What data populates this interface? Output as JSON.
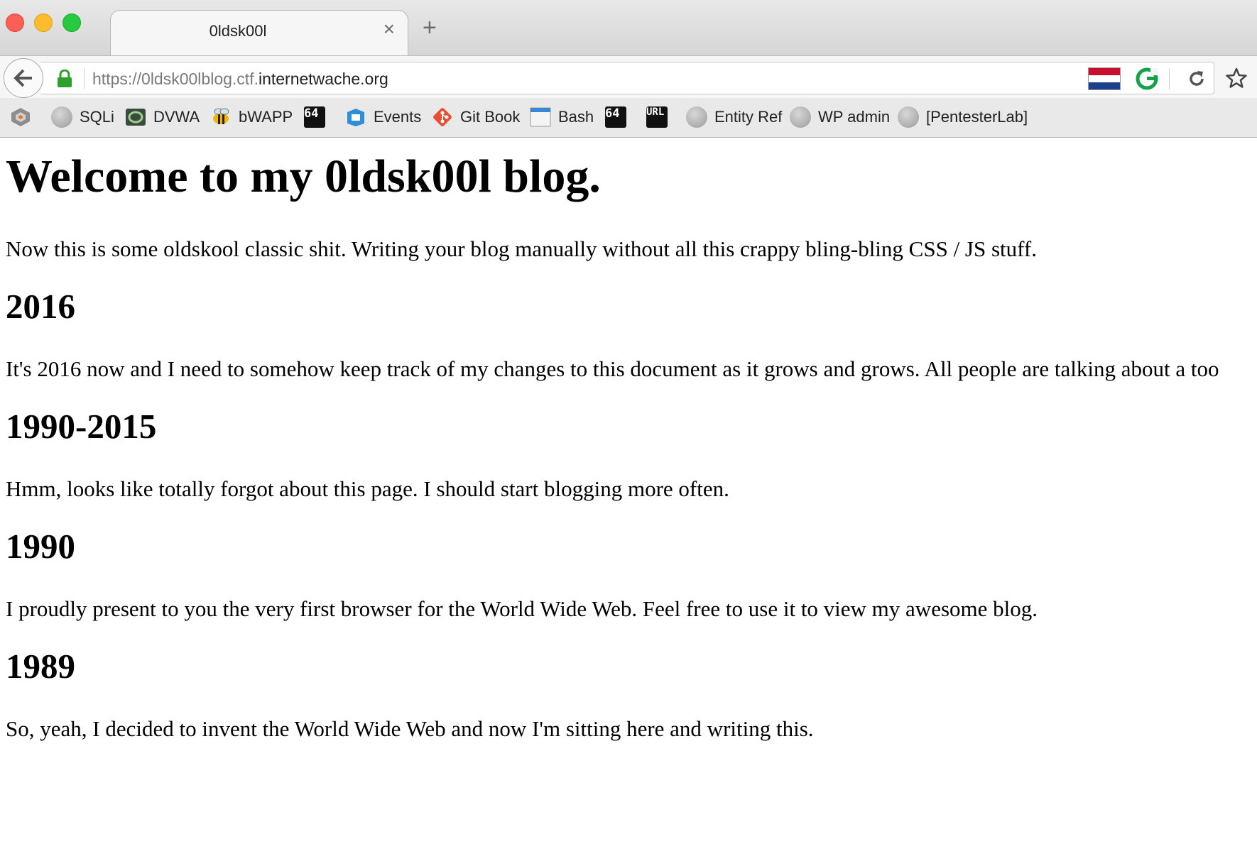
{
  "browser": {
    "tab": {
      "title": "0ldsk00l",
      "close_glyph": "×"
    },
    "new_tab_glyph": "+",
    "url": {
      "prefix": "https://0ldsk00lblog.ctf.",
      "domain": "internetwache.org"
    },
    "icons": {
      "back": "back-arrow-icon",
      "lock": "lock-icon",
      "flag": "netherlands-flag-icon",
      "extension": "grammarly-icon",
      "reload": "reload-icon",
      "bookmark_star": "star-icon"
    },
    "bookmarks": [
      {
        "label": "",
        "icon": "hackbar-icon"
      },
      {
        "label": "SQLi",
        "icon": "globe-icon"
      },
      {
        "label": "DVWA",
        "icon": "dvwa-icon"
      },
      {
        "label": "bWAPP",
        "icon": "bee-icon"
      },
      {
        "label": "",
        "icon": "base64-icon",
        "glyph": "64"
      },
      {
        "label": "Events",
        "icon": "events-icon"
      },
      {
        "label": "Git Book",
        "icon": "git-icon"
      },
      {
        "label": "Bash",
        "icon": "bash-icon"
      },
      {
        "label": "",
        "icon": "base64-icon",
        "glyph": "64"
      },
      {
        "label": "",
        "icon": "url-icon",
        "glyph": "URL"
      },
      {
        "label": "Entity Ref",
        "icon": "globe-icon"
      },
      {
        "label": "WP admin",
        "icon": "globe-icon"
      },
      {
        "label": "[PentesterLab]",
        "icon": "globe-icon"
      }
    ]
  },
  "page": {
    "heading": "Welcome to my 0ldsk00l blog.",
    "intro": "Now this is some oldskool classic shit. Writing your blog manually without all this crappy bling-bling CSS / JS stuff.",
    "sections": [
      {
        "title": "2016",
        "text": "It's 2016 now and I need to somehow keep track of my changes to this document as it grows and grows. All people are talking about a too"
      },
      {
        "title": "1990-2015",
        "text": "Hmm, looks like totally forgot about this page. I should start blogging more often."
      },
      {
        "title": "1990",
        "text": "I proudly present to you the very first browser for the World Wide Web. Feel free to use it to view my awesome blog."
      },
      {
        "title": "1989",
        "text": "So, yeah, I decided to invent the World Wide Web and now I'm sitting here and writing this."
      }
    ]
  }
}
